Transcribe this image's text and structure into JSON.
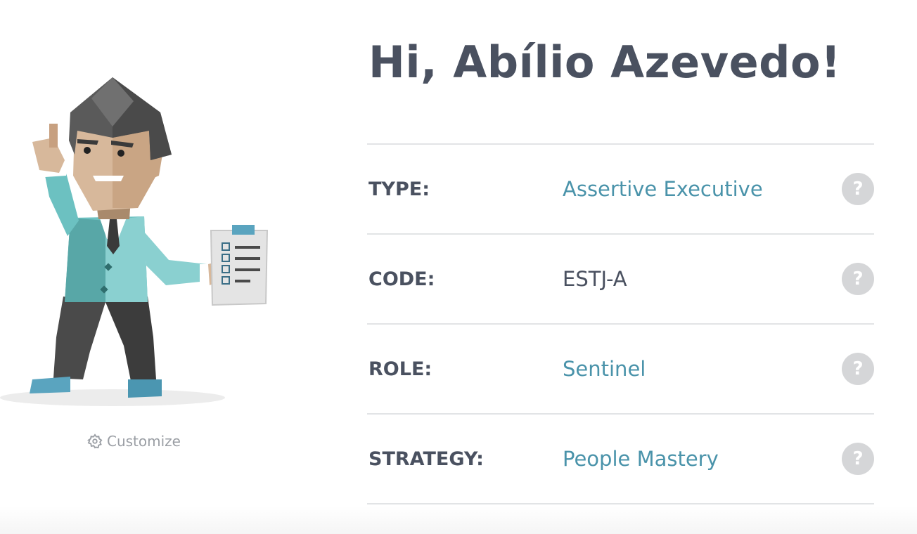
{
  "profile": {
    "greeting": "Hi, Abílio Azevedo!",
    "customize_label": "Customize",
    "avatar_icon": "executive-avatar-illustration"
  },
  "traits": [
    {
      "label": "TYPE:",
      "value": "Assertive Executive",
      "is_link": true,
      "help": "?"
    },
    {
      "label": "CODE:",
      "value": "ESTJ-A",
      "is_link": false,
      "help": "?"
    },
    {
      "label": "ROLE:",
      "value": "Sentinel",
      "is_link": true,
      "help": "?"
    },
    {
      "label": "STRATEGY:",
      "value": "People Mastery",
      "is_link": true,
      "help": "?"
    }
  ],
  "colors": {
    "heading": "#4a5160",
    "link": "#4a93aa",
    "muted": "#9a9ea4",
    "divider": "#e2e4e6",
    "help_badge": "#d5d6d8"
  }
}
